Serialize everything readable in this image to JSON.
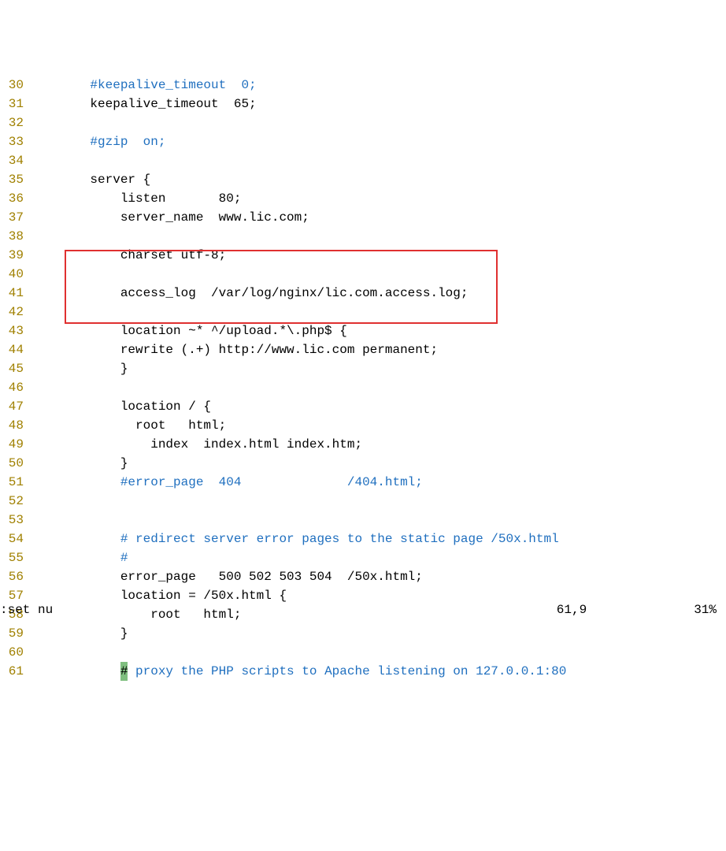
{
  "lines": [
    {
      "num": "30",
      "segments": [
        {
          "t": "    ",
          "c": "code"
        },
        {
          "t": "#keepalive_timeout  0;",
          "c": "comment"
        }
      ]
    },
    {
      "num": "31",
      "segments": [
        {
          "t": "    keepalive_timeout  65;",
          "c": "code"
        }
      ]
    },
    {
      "num": "32",
      "segments": [
        {
          "t": "",
          "c": "code"
        }
      ]
    },
    {
      "num": "33",
      "segments": [
        {
          "t": "    ",
          "c": "code"
        },
        {
          "t": "#gzip  on;",
          "c": "comment"
        }
      ]
    },
    {
      "num": "34",
      "segments": [
        {
          "t": "",
          "c": "code"
        }
      ]
    },
    {
      "num": "35",
      "segments": [
        {
          "t": "    server {",
          "c": "code"
        }
      ]
    },
    {
      "num": "36",
      "segments": [
        {
          "t": "        listen       80;",
          "c": "code"
        }
      ]
    },
    {
      "num": "37",
      "segments": [
        {
          "t": "        server_name  www.lic.com;",
          "c": "code"
        }
      ]
    },
    {
      "num": "38",
      "segments": [
        {
          "t": "",
          "c": "code"
        }
      ]
    },
    {
      "num": "39",
      "segments": [
        {
          "t": "        charset utf-8;",
          "c": "code"
        }
      ]
    },
    {
      "num": "40",
      "segments": [
        {
          "t": "",
          "c": "code"
        }
      ]
    },
    {
      "num": "41",
      "segments": [
        {
          "t": "        access_log  /var/log/nginx/lic.com.access.log;",
          "c": "code"
        }
      ]
    },
    {
      "num": "42",
      "segments": [
        {
          "t": "",
          "c": "code"
        }
      ]
    },
    {
      "num": "43",
      "segments": [
        {
          "t": "        location ~* ^/upload.*\\.php$ {",
          "c": "code"
        }
      ]
    },
    {
      "num": "44",
      "segments": [
        {
          "t": "        rewrite (.+) http://www.lic.com permanent;",
          "c": "code"
        }
      ]
    },
    {
      "num": "45",
      "segments": [
        {
          "t": "        }",
          "c": "code"
        }
      ]
    },
    {
      "num": "46",
      "segments": [
        {
          "t": "",
          "c": "code"
        }
      ]
    },
    {
      "num": "47",
      "segments": [
        {
          "t": "        location / {",
          "c": "code"
        }
      ]
    },
    {
      "num": "48",
      "segments": [
        {
          "t": "          root   html;",
          "c": "code"
        }
      ]
    },
    {
      "num": "49",
      "segments": [
        {
          "t": "            index  index.html index.htm;",
          "c": "code"
        }
      ]
    },
    {
      "num": "50",
      "segments": [
        {
          "t": "        }",
          "c": "code"
        }
      ]
    },
    {
      "num": "51",
      "segments": [
        {
          "t": "        ",
          "c": "code"
        },
        {
          "t": "#error_page  404              /404.html;",
          "c": "comment"
        }
      ]
    },
    {
      "num": "52",
      "segments": [
        {
          "t": "",
          "c": "code"
        }
      ]
    },
    {
      "num": "53",
      "segments": [
        {
          "t": "",
          "c": "code"
        }
      ]
    },
    {
      "num": "54",
      "segments": [
        {
          "t": "        ",
          "c": "code"
        },
        {
          "t": "# redirect server error pages to the static page /50x.html",
          "c": "comment"
        }
      ]
    },
    {
      "num": "55",
      "segments": [
        {
          "t": "        ",
          "c": "code"
        },
        {
          "t": "#",
          "c": "comment"
        }
      ]
    },
    {
      "num": "56",
      "segments": [
        {
          "t": "        error_page   500 502 503 504  /50x.html;",
          "c": "code"
        }
      ]
    },
    {
      "num": "57",
      "segments": [
        {
          "t": "        location = /50x.html {",
          "c": "code"
        }
      ]
    },
    {
      "num": "58",
      "segments": [
        {
          "t": "            root   html;",
          "c": "code"
        }
      ]
    },
    {
      "num": "59",
      "segments": [
        {
          "t": "        }",
          "c": "code"
        }
      ]
    },
    {
      "num": "60",
      "segments": [
        {
          "t": "",
          "c": "code"
        }
      ]
    },
    {
      "num": "61",
      "segments": [
        {
          "t": "        ",
          "c": "code"
        },
        {
          "t": "#",
          "c": "comment",
          "cursor": true
        },
        {
          "t": " proxy the PHP scripts to Apache listening on 127.0.0.1:80",
          "c": "comment"
        }
      ]
    }
  ],
  "status": {
    "command": ":set nu",
    "position": "61,9",
    "percent": "31%"
  }
}
